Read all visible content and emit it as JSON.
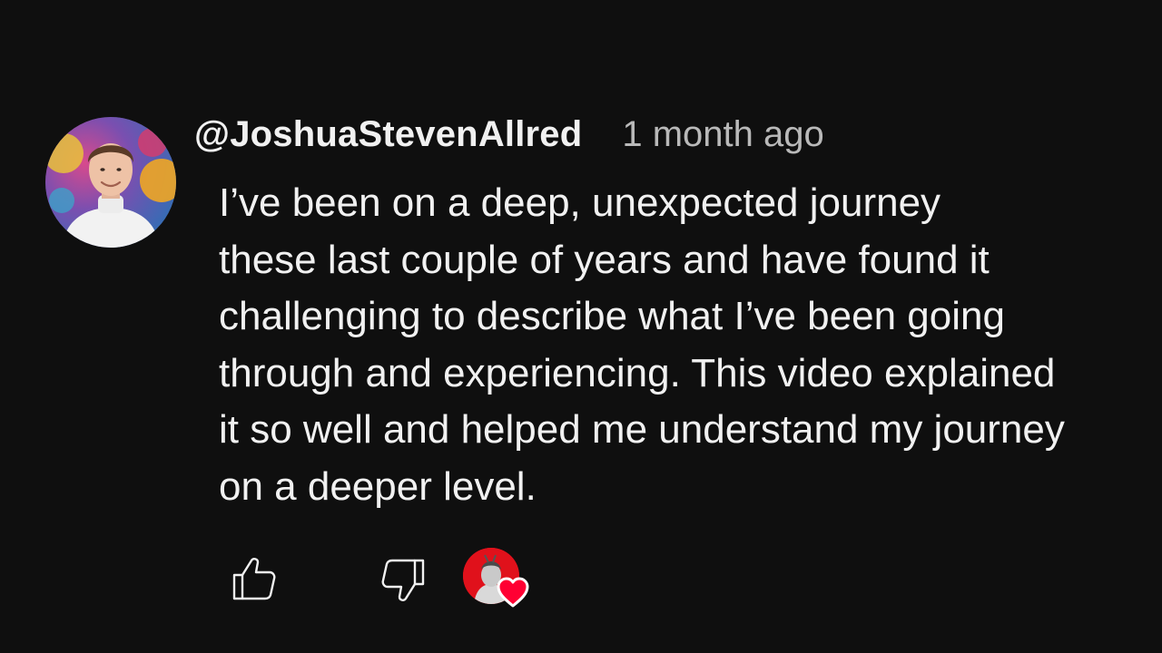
{
  "comment": {
    "author": "@JoshuaStevenAllred",
    "time": "1 month ago",
    "text_lines": [
      "I’ve been on a deep, unexpected journey",
      "these last couple of years and have found it",
      "challenging to describe what I’ve been going",
      "through and experiencing. This video explained",
      "it so well and helped me understand my journey",
      "on a deeper level."
    ]
  },
  "icons": {
    "like": "thumbs-up-icon",
    "dislike": "thumbs-down-icon",
    "creator_heart": "heart-icon"
  },
  "colors": {
    "background": "#0f0f0f",
    "text": "#f1f1f1",
    "secondary_text": "#b9b9b9",
    "heart": "#ff0033",
    "creator_badge": "#e0111b"
  }
}
